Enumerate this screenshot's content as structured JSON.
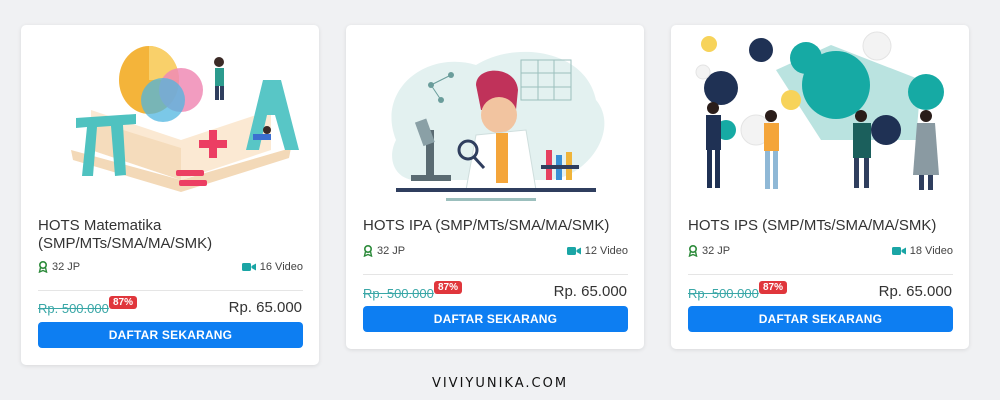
{
  "colors": {
    "accent": "#0d7ef2",
    "badge": "#e0363c",
    "old_price": "#3aa7a7",
    "icon_teal": "#1aa5a5",
    "jp_icon": "#2c8a3a"
  },
  "cards": [
    {
      "title": "HOTS Matematika (SMP/MTs/SMA/MA/SMK)",
      "jp": "32 JP",
      "videos": "16 Video",
      "old_price": "Rp. 500.000",
      "discount": "87%",
      "price": "Rp. 65.000",
      "button": "DAFTAR SEKARANG",
      "image": "math-illustration"
    },
    {
      "title": "HOTS IPA (SMP/MTs/SMA/MA/SMK)",
      "jp": "32 JP",
      "videos": "12 Video",
      "old_price": "Rp. 500.000",
      "discount": "87%",
      "price": "Rp. 65.000",
      "button": "DAFTAR SEKARANG",
      "image": "science-illustration"
    },
    {
      "title": "HOTS IPS (SMP/MTs/SMA/MA/SMK)",
      "jp": "32 JP",
      "videos": "18 Video",
      "old_price": "Rp. 500.000",
      "discount": "87%",
      "price": "Rp. 65.000",
      "button": "DAFTAR SEKARANG",
      "image": "social-illustration"
    }
  ],
  "watermark": "VIVIYUNIKA.COM"
}
